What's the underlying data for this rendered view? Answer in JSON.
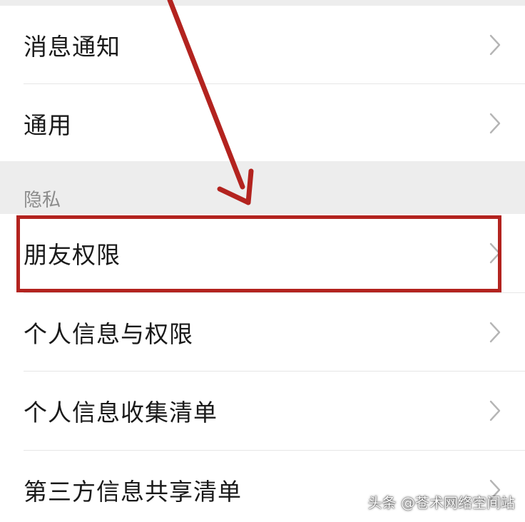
{
  "menu_top": [
    {
      "label": "消息通知",
      "icon": "chevron-right-icon"
    },
    {
      "label": "通用",
      "icon": "chevron-right-icon"
    }
  ],
  "section": {
    "title": "隐私"
  },
  "menu_privacy": [
    {
      "label": "朋友权限",
      "icon": "chevron-right-icon"
    },
    {
      "label": "个人信息与权限",
      "icon": "chevron-right-icon"
    },
    {
      "label": "个人信息收集清单",
      "icon": "chevron-right-icon"
    },
    {
      "label": "第三方信息共享清单",
      "icon": "chevron-right-icon"
    }
  ],
  "annotation": {
    "color": "#b3231f",
    "highlighted_item": "朋友权限"
  },
  "watermark": "头条 @苍术网络空间站"
}
